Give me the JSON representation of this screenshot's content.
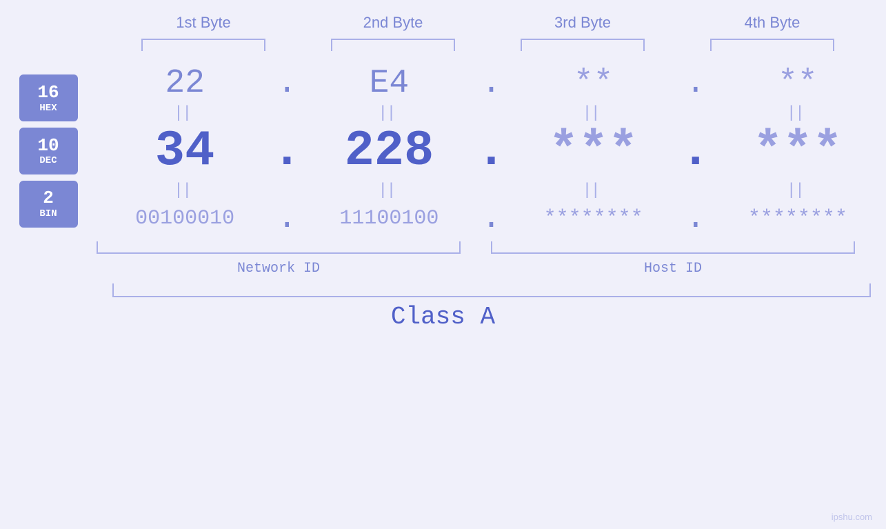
{
  "headers": {
    "byte1": "1st Byte",
    "byte2": "2nd Byte",
    "byte3": "3rd Byte",
    "byte4": "4th Byte"
  },
  "badges": {
    "hex": {
      "number": "16",
      "label": "HEX"
    },
    "dec": {
      "number": "10",
      "label": "DEC"
    },
    "bin": {
      "number": "2",
      "label": "BIN"
    }
  },
  "hex_row": {
    "b1": "22",
    "b2": "E4",
    "b3": "**",
    "b4": "**",
    "dot": "."
  },
  "dec_row": {
    "b1": "34",
    "b2": "228",
    "b3": "***",
    "b4": "***",
    "dot": "."
  },
  "bin_row": {
    "b1": "00100010",
    "b2": "11100100",
    "b3": "********",
    "b4": "********",
    "dot": "."
  },
  "labels": {
    "network_id": "Network ID",
    "host_id": "Host ID",
    "class": "Class A"
  },
  "watermark": "ipshu.com",
  "eq": "||"
}
